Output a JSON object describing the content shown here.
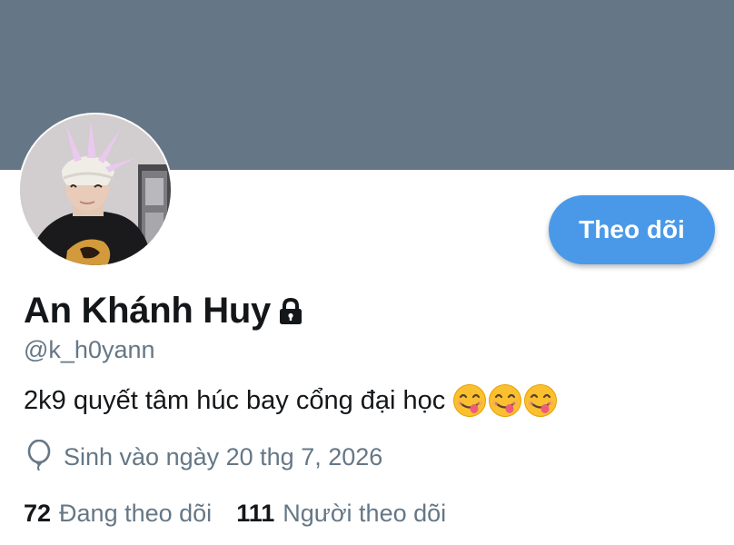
{
  "colors": {
    "banner": "#657786",
    "accent": "#4a99e9",
    "text_primary": "#14171a",
    "text_secondary": "#657786"
  },
  "profile": {
    "display_name": "An Khánh Huy",
    "protected_icon": "lock-icon",
    "handle": "@k_h0yann",
    "bio": "2k9 quyết tâm húc bay cổng đại học",
    "bio_emoji": [
      "face-savoring-food-emoji",
      "face-savoring-food-emoji",
      "face-savoring-food-emoji"
    ],
    "birth_icon": "balloon-icon",
    "birth": "Sinh vào ngày 20 thg 7, 2026"
  },
  "actions": {
    "follow_label": "Theo dõi"
  },
  "stats": {
    "following_count": "72",
    "following_label": "Đang theo dõi",
    "followers_count": "111",
    "followers_label": "Người theo dõi"
  }
}
